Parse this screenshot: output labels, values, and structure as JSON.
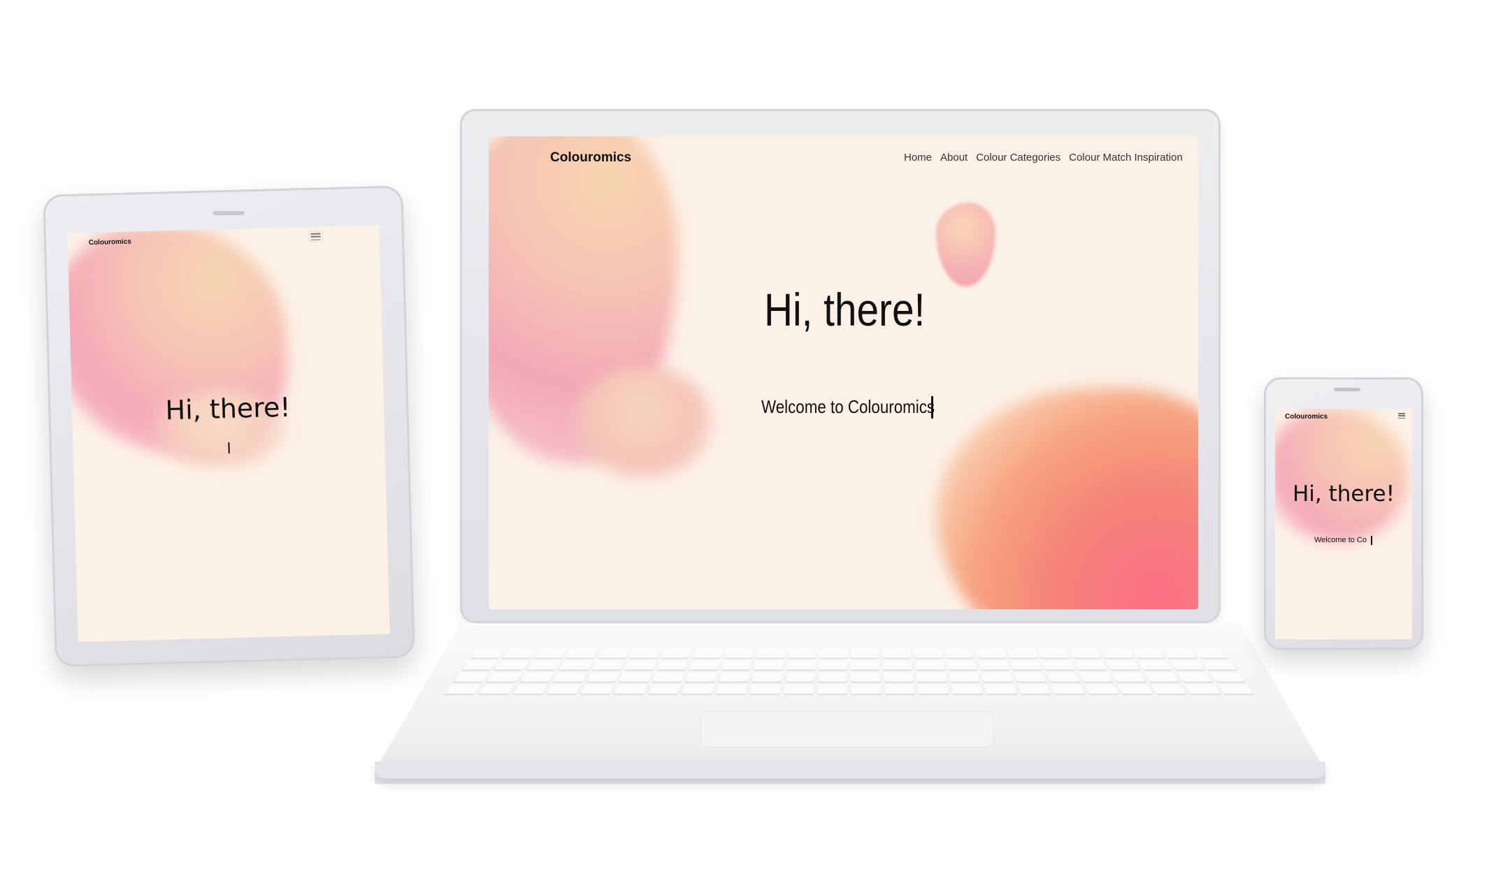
{
  "brand": "Colouromics",
  "laptop": {
    "nav": [
      "Home",
      "About",
      "Colour Categories",
      "Colour Match Inspiration"
    ],
    "heading": "Hi, there!",
    "welcome": "Welcome to Colouromics"
  },
  "tablet": {
    "heading": "Hi, there!",
    "welcome": ""
  },
  "phone": {
    "heading": "Hi, there!",
    "welcome": "Welcome to Co"
  },
  "icons": {
    "menu": "hamburger-menu-icon"
  },
  "colors": {
    "page_bg": "#fcf1e7",
    "blob_pink": "#f4a3b7",
    "blob_peach": "#f8d5b4",
    "blob_coral": "#f48a7c"
  }
}
